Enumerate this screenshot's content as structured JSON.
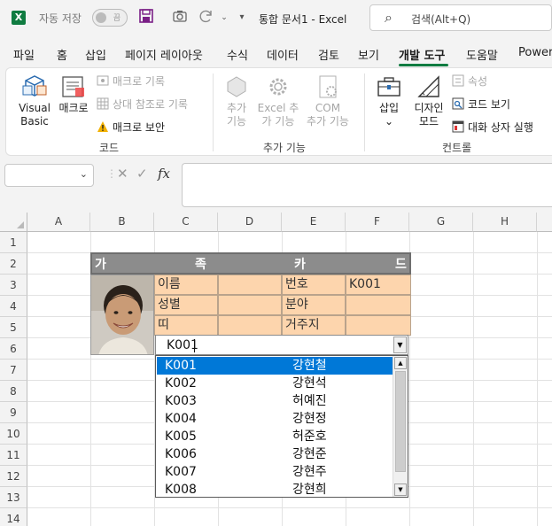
{
  "titlebar": {
    "logo_letter": "X",
    "autosave_label": "자동 저장",
    "autosave_state": "끔",
    "doc_title": "통합 문서1  -  Excel",
    "search_placeholder": "검색(Alt+Q)"
  },
  "tabs": [
    {
      "label": "파일"
    },
    {
      "label": "홈"
    },
    {
      "label": "삽입"
    },
    {
      "label": "페이지 레이아웃"
    },
    {
      "label": "수식"
    },
    {
      "label": "데이터"
    },
    {
      "label": "검토"
    },
    {
      "label": "보기"
    },
    {
      "label": "개발 도구",
      "active": true
    },
    {
      "label": "도움말"
    },
    {
      "label": "Power"
    }
  ],
  "ribbon": {
    "code_group": {
      "visual_basic_l1": "Visual",
      "visual_basic_l2": "Basic",
      "macro": "매크로",
      "record_macro": "매크로 기록",
      "relative_ref": "상대 참조로 기록",
      "macro_security": "매크로 보안",
      "label": "코드"
    },
    "addins_group": {
      "addins_l1": "추가",
      "addins_l2": "기능",
      "excel_addins_l1": "Excel 추",
      "excel_addins_l2": "가 기능",
      "com_addins_l1": "COM",
      "com_addins_l2": "추가 기능",
      "label": "추가 기능"
    },
    "controls_group": {
      "insert": "삽입",
      "design_mode_l1": "디자인",
      "design_mode_l2": "모드",
      "properties": "속성",
      "view_code": "코드 보기",
      "run_dialog": "대화 상자 실행",
      "label": "컨트롤"
    }
  },
  "formula_bar": {
    "name_box_value": "",
    "fx_label": "fx",
    "formula_value": ""
  },
  "sheet": {
    "columns": [
      "A",
      "B",
      "C",
      "D",
      "E",
      "F",
      "G",
      "H"
    ],
    "rows": [
      "1",
      "2",
      "3",
      "4",
      "5",
      "6",
      "7",
      "8",
      "9",
      "10",
      "11",
      "12",
      "13",
      "14",
      "15"
    ]
  },
  "card": {
    "title_chars": [
      "가",
      "족",
      "카",
      "드"
    ],
    "labels": {
      "name": "이름",
      "number": "번호",
      "gender": "성별",
      "field": "분야",
      "zodiac": "띠",
      "residence": "거주지"
    },
    "values": {
      "number": "K001"
    }
  },
  "combo": {
    "value": "K001",
    "items": [
      {
        "code": "K001",
        "name": "강현철",
        "selected": true
      },
      {
        "code": "K002",
        "name": "강현석"
      },
      {
        "code": "K003",
        "name": "허예진"
      },
      {
        "code": "K004",
        "name": "강현정"
      },
      {
        "code": "K005",
        "name": "허준호"
      },
      {
        "code": "K006",
        "name": "강현준"
      },
      {
        "code": "K007",
        "name": "강현주"
      },
      {
        "code": "K008",
        "name": "강현희"
      }
    ]
  },
  "colors": {
    "excel_green": "#107c41",
    "card_fill": "#fdd5ad",
    "title_fill": "#8c8c8c",
    "selection_blue": "#0078d7"
  }
}
